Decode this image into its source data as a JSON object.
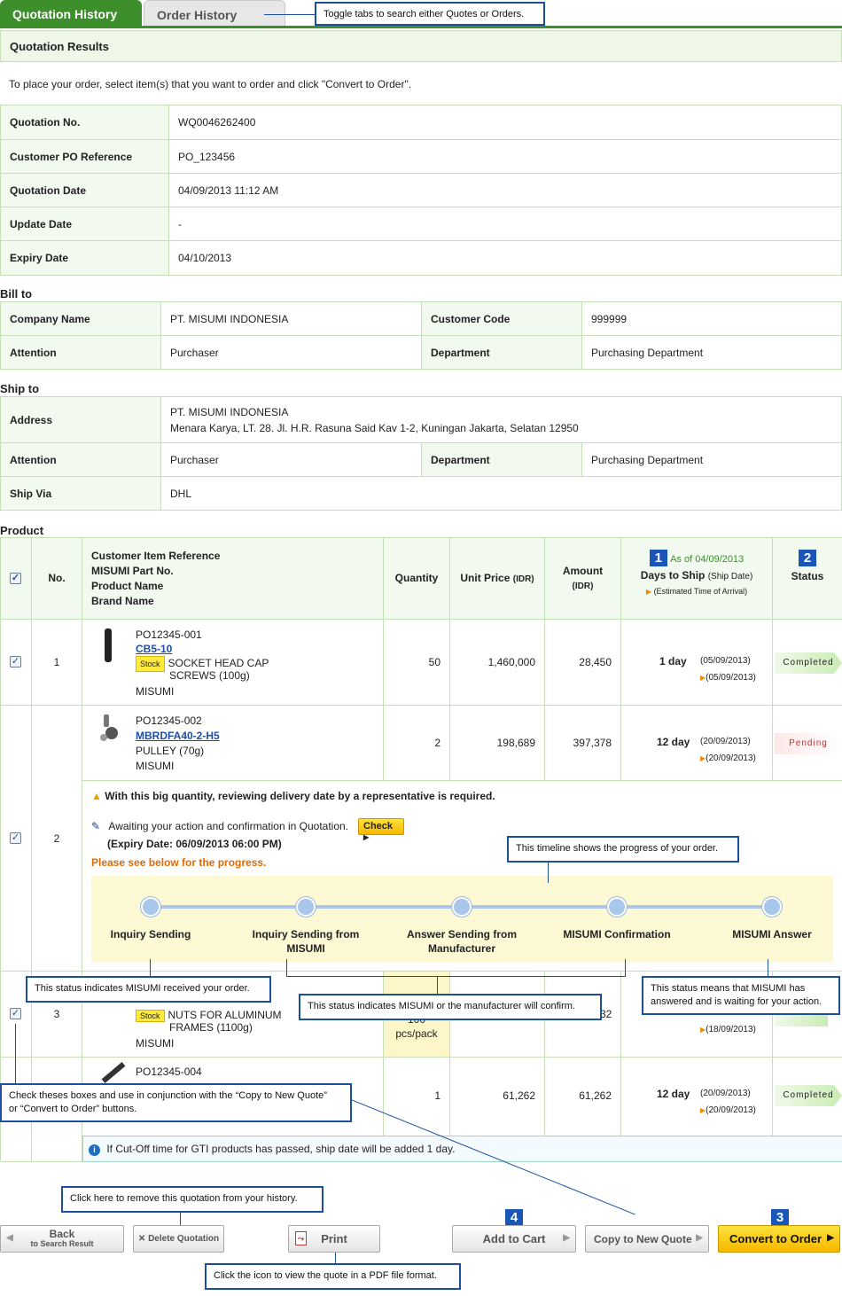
{
  "tabs": {
    "quotation_history": "Quotation History",
    "order_history": "Order History"
  },
  "callouts": {
    "tabs": "Toggle tabs to search either Quotes or Orders.",
    "timeline": "This timeline shows the progress of your order.",
    "received": "This status indicates MISUMI received your order.",
    "confirm": "This status indicates MISUMI or the manufacturer will confirm.",
    "answered_line1": "This status means that MISUMI has",
    "answered_line2": "answered and is waiting for your action.",
    "checkboxes_line1": "Check theses boxes and use in conjunction with the “Copy to New Quote”",
    "checkboxes_line2": "or “Convert to Order” buttons.",
    "delete": "Click here to remove this quotation from your history.",
    "print": "Click the icon to view the quote in a PDF file format."
  },
  "section_title": "Quotation Results",
  "intro": "To place your order, select item(s) that you want to order and click \"Convert to Order\".",
  "quotation": {
    "no_label": "Quotation No.",
    "no": "WQ0046262400",
    "po_label": "Customer PO Reference",
    "po": "PO_123456",
    "date_label": "Quotation Date",
    "date": "04/09/2013 11:12 AM",
    "update_label": "Update Date",
    "update": "-",
    "expiry_label": "Expiry Date",
    "expiry": "04/10/2013"
  },
  "bill_to": {
    "title": "Bill to",
    "company_label": "Company Name",
    "company": "PT. MISUMI INDONESIA",
    "code_label": "Customer Code",
    "code": "999999",
    "attention_label": "Attention",
    "attention": "Purchaser",
    "dept_label": "Department",
    "dept": "Purchasing Department"
  },
  "ship_to": {
    "title": "Ship to",
    "address_label": "Address",
    "address_line1": "PT. MISUMI INDONESIA",
    "address_line2": "Menara Karya, LT. 28. Jl. H.R. Rasuna Said Kav 1-2, Kuningan Jakarta, Selatan 12950",
    "attention_label": "Attention",
    "attention": "Purchaser",
    "dept_label": "Department",
    "dept": "Purchasing Department",
    "via_label": "Ship Via",
    "via": "DHL"
  },
  "product": {
    "title": "Product",
    "headers": {
      "no": "No.",
      "item_ref": "Customer Item Reference",
      "part_no": "MISUMI Part No.",
      "product_name": "Product Name",
      "brand": "Brand Name",
      "quantity": "Quantity",
      "unit_price": "Unit Price",
      "unit_price_unit": "(IDR)",
      "amount": "Amount",
      "amount_unit": "(IDR)",
      "badge1": "1",
      "as_of": "As of 04/09/2013",
      "days_to_ship": "Days to Ship",
      "ship_date": "(Ship Date)",
      "eta": "(Estimated Time of Arrival)",
      "badge2": "2",
      "status": "Status"
    },
    "rows": [
      {
        "no": "1",
        "ref": "PO12345-001",
        "part": "CB5-10",
        "stock": "Stock",
        "name1": "SOCKET HEAD CAP",
        "name2": "SCREWS (100g)",
        "brand": "MISUMI",
        "qty": "50",
        "unit": "1,460,000",
        "amount": "28,450",
        "days": "1 day",
        "ship": "(05/09/2013)",
        "eta": "(05/09/2013)",
        "status": "Completed"
      },
      {
        "no": "2",
        "ref": "PO12345-002",
        "part": "MBRDFA40-2-H5",
        "name1": "PULLEY (70g)",
        "brand": "MISUMI",
        "qty": "2",
        "unit": "198,689",
        "amount": "397,378",
        "days": "12 day",
        "ship": "(20/09/2013)",
        "eta": "(20/09/2013)",
        "status": "Pending"
      },
      {
        "no": "3",
        "stock": "Stock",
        "name1": "NUTS FOR ALUMINUM",
        "name2": "FRAMES (1100g)",
        "brand": "MISUMI",
        "qty_line1": "100",
        "qty_line2": "pcs/pack",
        "amount": "32",
        "eta": "(18/09/2013)"
      },
      {
        "no": "4",
        "ref": "PO12345-004",
        "qty": "1",
        "unit": "61,262",
        "amount": "61,262",
        "days": "12 day",
        "ship": "(20/09/2013)",
        "eta": "(20/09/2013)",
        "status": "Completed"
      }
    ],
    "warning": "With this big quantity, reviewing delivery date by a representative is required.",
    "awaiting": "Awaiting your action and confirmation in Quotation.",
    "check_btn": "Check",
    "expiry_note": "(Expiry Date: 06/09/2013 06:00 PM)",
    "progress_note": "Please see below for the progress.",
    "timeline": [
      {
        "line1": "Inquiry Sending",
        "line2": ""
      },
      {
        "line1": "Inquiry Sending from",
        "line2": "MISUMI"
      },
      {
        "line1": "Answer Sending from",
        "line2": "Manufacturer"
      },
      {
        "line1": "MISUMI Confirmation",
        "line2": ""
      },
      {
        "line1": "MISUMI Answer",
        "line2": ""
      }
    ],
    "cutoff_note": "If Cut-Off time for GTI products has passed, ship date will be added 1 day."
  },
  "buttons": {
    "back": "Back",
    "back_sub": "to Search Result",
    "delete": "Delete Quotation",
    "print": "Print",
    "add_cart": "Add to Cart",
    "copy_quote": "Copy to New Quote",
    "convert": "Convert to Order",
    "badge4": "4",
    "badge3": "3"
  },
  "colors": {
    "brand_green": "#3d8f2b",
    "callout_blue": "#1d4fa0",
    "primary_button": "#f5b800",
    "pending_red": "#c0303a"
  }
}
